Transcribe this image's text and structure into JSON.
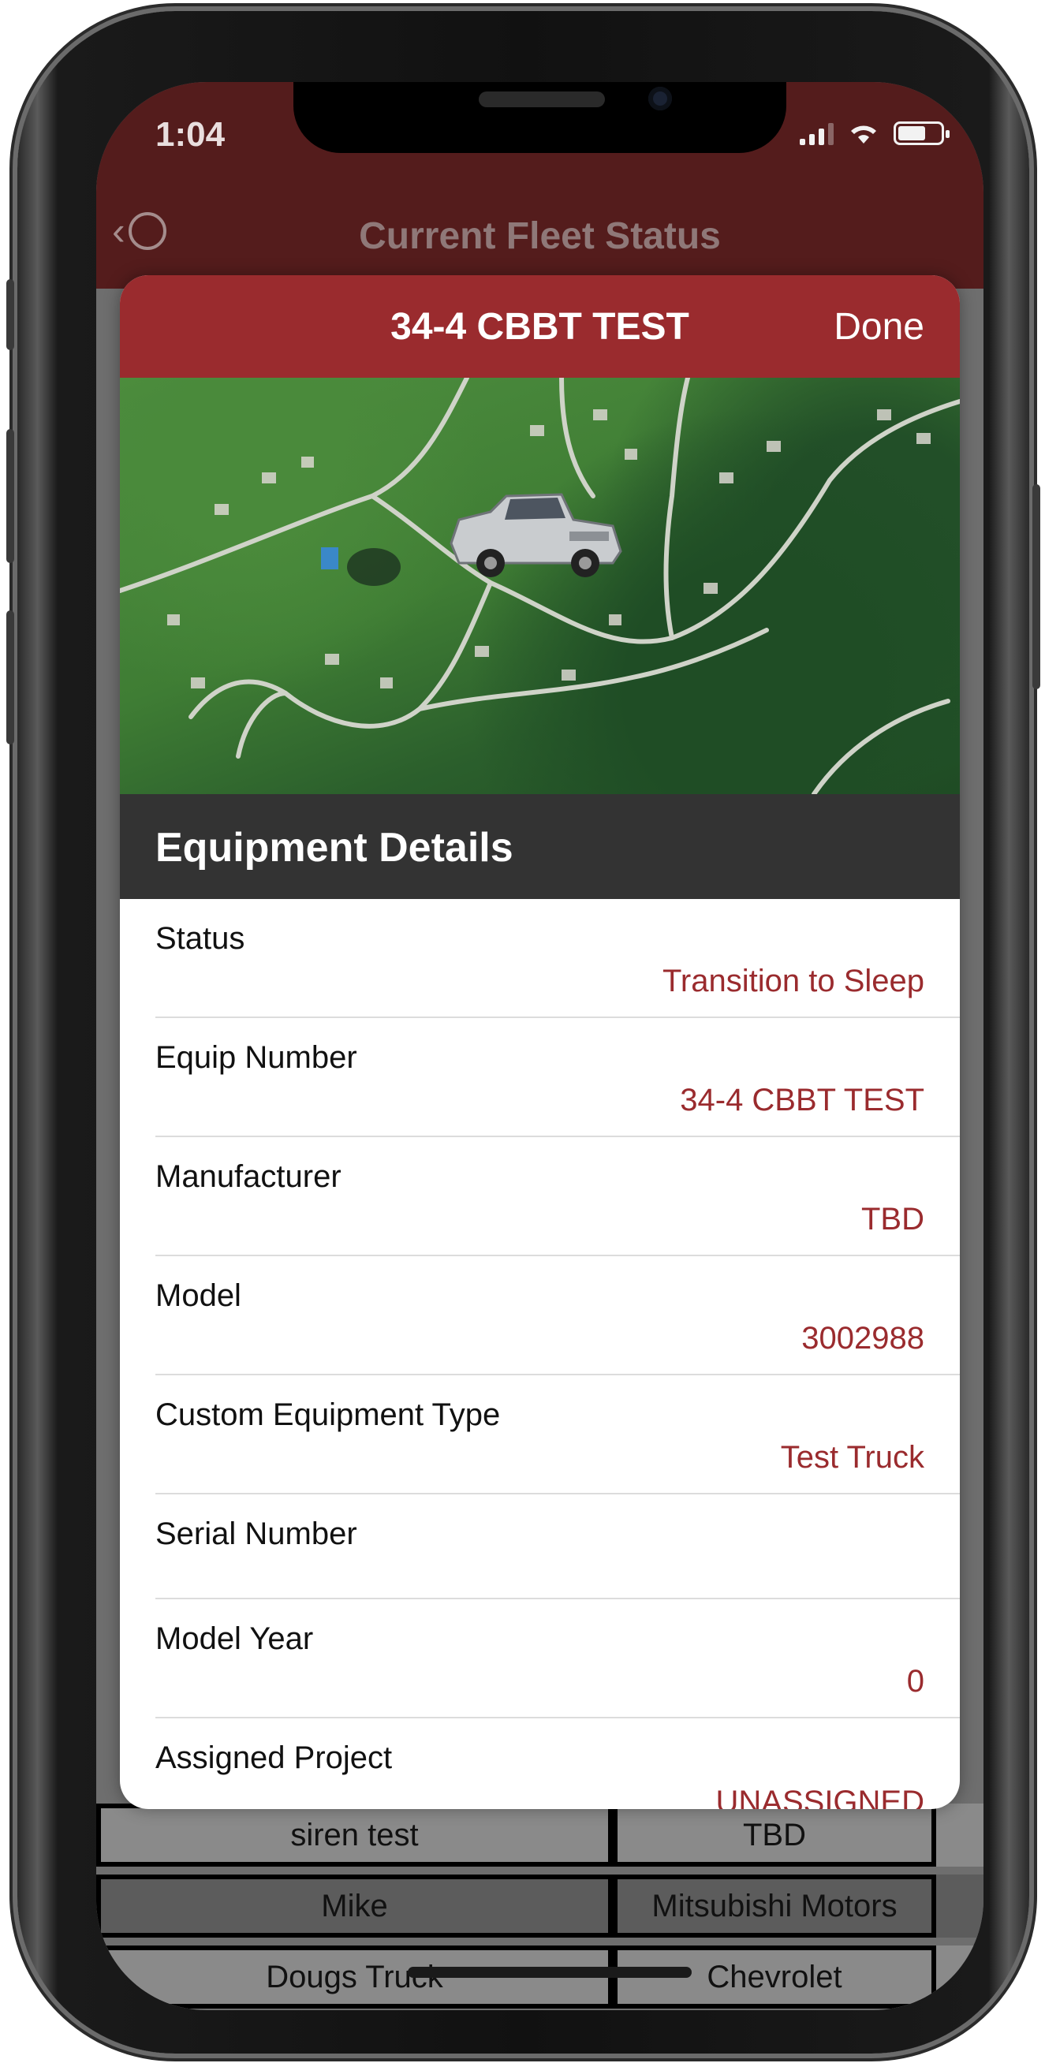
{
  "status_bar": {
    "time": "1:04"
  },
  "nav": {
    "title": "Current Fleet Status"
  },
  "modal": {
    "title": "34-4 CBBT TEST",
    "done_label": "Done",
    "section_title": "Equipment Details",
    "details": [
      {
        "label": "Status",
        "value": "Transition to Sleep"
      },
      {
        "label": "Equip Number",
        "value": "34-4 CBBT TEST"
      },
      {
        "label": "Manufacturer",
        "value": "TBD"
      },
      {
        "label": "Model",
        "value": "3002988"
      },
      {
        "label": "Custom Equipment Type",
        "value": "Test Truck"
      },
      {
        "label": "Serial Number",
        "value": ""
      },
      {
        "label": "Model Year",
        "value": "0"
      },
      {
        "label": "Assigned Project",
        "value": "UNASSIGNED"
      }
    ]
  },
  "background_table": {
    "rows": [
      {
        "name": "siren test",
        "manufacturer": "TBD"
      },
      {
        "name": "Mike",
        "manufacturer": "Mitsubishi Motors"
      },
      {
        "name": "Dougs Truck",
        "manufacturer": "Chevrolet"
      }
    ]
  },
  "colors": {
    "accent": "#9a2b2e",
    "navbar": "#541c1c",
    "section": "#333333"
  }
}
